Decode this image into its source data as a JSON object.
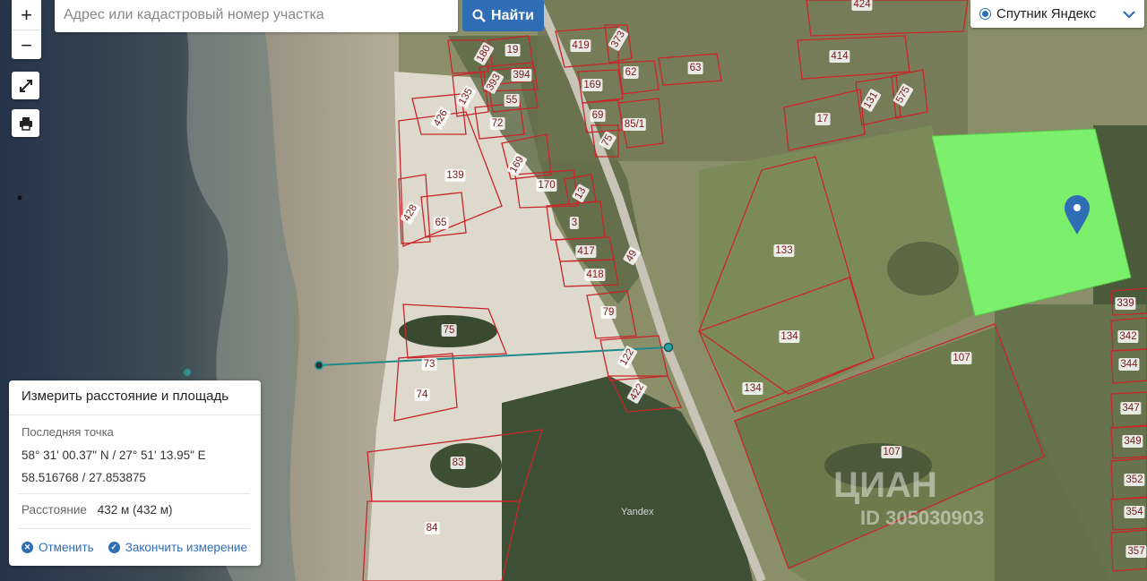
{
  "map": {
    "zoom_in": "+",
    "zoom_out": "−",
    "fullscreen_icon": "expand-icon",
    "print_icon": "printer-icon"
  },
  "search": {
    "placeholder": "Адрес или кадастровый номер участка",
    "button_label": "Найти",
    "button_icon": "search-icon"
  },
  "layer_selector": {
    "selected": "Спутник Яндекс"
  },
  "measure_panel": {
    "title": "Измерить расстояние и площадь",
    "last_point_label": "Последняя точка",
    "coordinates_dms": "58° 31' 00.37\" N / 27° 51' 13.95\" E",
    "coordinates_decimal": "58.516768 / 27.853875",
    "distance_label": "Расстояние",
    "distance_value": "432 м (432 м)",
    "cancel_label": "Отменить",
    "finish_label": "Закончить измерение"
  },
  "parcels": [
    {
      "id": "p424",
      "label": "424"
    },
    {
      "id": "p419",
      "label": "419"
    },
    {
      "id": "p373",
      "label": "373"
    },
    {
      "id": "p180",
      "label": "180"
    },
    {
      "id": "p19",
      "label": "19"
    },
    {
      "id": "p394",
      "label": "394"
    },
    {
      "id": "p393",
      "label": "393"
    },
    {
      "id": "p414",
      "label": "414"
    },
    {
      "id": "p169a",
      "label": "169"
    },
    {
      "id": "p62",
      "label": "62"
    },
    {
      "id": "p63",
      "label": "63"
    },
    {
      "id": "p135",
      "label": "135"
    },
    {
      "id": "p55",
      "label": "55"
    },
    {
      "id": "p131",
      "label": "131"
    },
    {
      "id": "p575",
      "label": "575"
    },
    {
      "id": "p426",
      "label": "426"
    },
    {
      "id": "p72",
      "label": "72"
    },
    {
      "id": "p69",
      "label": "69"
    },
    {
      "id": "p851",
      "label": "85/1"
    },
    {
      "id": "p17",
      "label": "17"
    },
    {
      "id": "p75a",
      "label": "75"
    },
    {
      "id": "p139",
      "label": "139"
    },
    {
      "id": "p169b",
      "label": "169"
    },
    {
      "id": "p170",
      "label": "170"
    },
    {
      "id": "p13",
      "label": "13"
    },
    {
      "id": "p428",
      "label": "428"
    },
    {
      "id": "p65",
      "label": "65"
    },
    {
      "id": "p3",
      "label": "3"
    },
    {
      "id": "p133",
      "label": "133"
    },
    {
      "id": "p417",
      "label": "417"
    },
    {
      "id": "p49",
      "label": "49"
    },
    {
      "id": "p418",
      "label": "418"
    },
    {
      "id": "p339",
      "label": "339"
    },
    {
      "id": "p79",
      "label": "79"
    },
    {
      "id": "p75b",
      "label": "75"
    },
    {
      "id": "p134a",
      "label": "134"
    },
    {
      "id": "p342",
      "label": "342"
    },
    {
      "id": "p107a",
      "label": "107"
    },
    {
      "id": "p122",
      "label": "122"
    },
    {
      "id": "p344",
      "label": "344"
    },
    {
      "id": "p73",
      "label": "73"
    },
    {
      "id": "p74",
      "label": "74"
    },
    {
      "id": "p134b",
      "label": "134"
    },
    {
      "id": "p422",
      "label": "422"
    },
    {
      "id": "p347",
      "label": "347"
    },
    {
      "id": "p349",
      "label": "349"
    },
    {
      "id": "p83",
      "label": "83"
    },
    {
      "id": "p107b",
      "label": "107"
    },
    {
      "id": "p352",
      "label": "352"
    },
    {
      "id": "p354",
      "label": "354"
    },
    {
      "id": "p84",
      "label": "84"
    },
    {
      "id": "p357",
      "label": "357"
    }
  ],
  "attribution": "Yandex",
  "watermark": "ЦИАН",
  "watermark_id": "ID 305030903"
}
